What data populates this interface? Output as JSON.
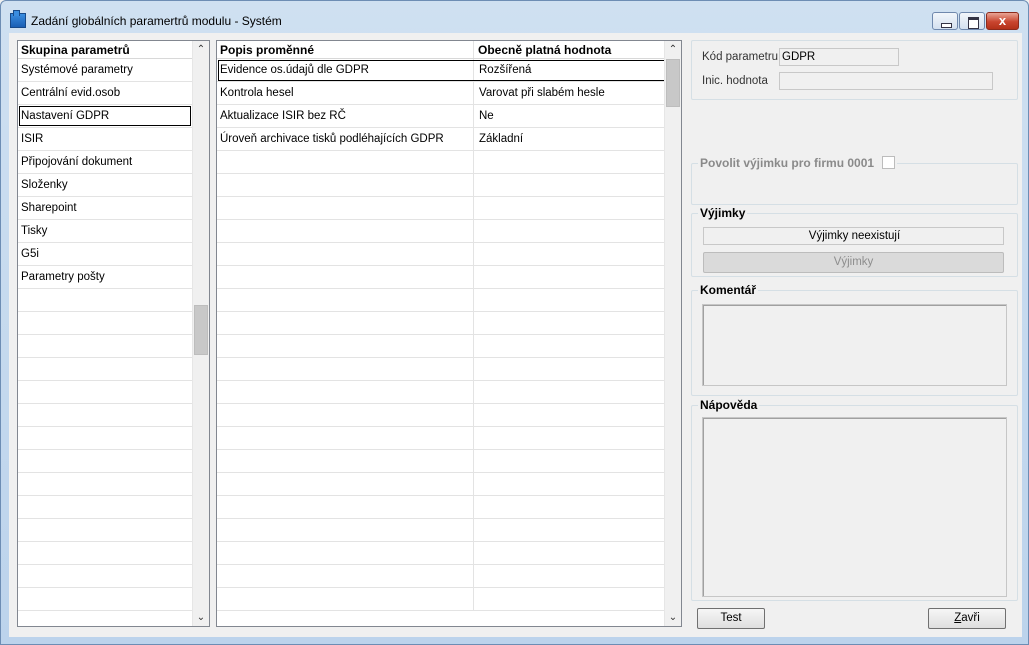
{
  "window": {
    "title": "Zadání globálních paramertrů modulu - Systém",
    "close_glyph": "x"
  },
  "left": {
    "header": "Skupina parametrů",
    "items": [
      "Systémové parametry",
      "Centrální evid.osob",
      "Nastavení GDPR",
      "ISIR",
      "Připojování dokument",
      "Složenky",
      "Sharepoint",
      "Tisky",
      "G5i",
      "Parametry pošty"
    ],
    "selected_index": 2
  },
  "middle": {
    "headers": [
      "Popis proměnné",
      "Obecně platná hodnota"
    ],
    "rows": [
      [
        "Evidence os.údajů dle GDPR",
        "Rozšířená"
      ],
      [
        "Kontrola hesel",
        "Varovat při slabém hesle"
      ],
      [
        "Aktualizace ISIR bez RČ",
        "Ne"
      ],
      [
        "Úroveň archivace tisků podléhajících GDPR",
        "Základní"
      ]
    ]
  },
  "right": {
    "kod_label": "Kód parametru",
    "kod_value": "GDPR",
    "inic_label": "Inic. hodnota",
    "inic_value": "",
    "povolit_label": "Povolit výjimku pro firmu 0001",
    "vyjimky_title": "Výjimky",
    "vyjimky_status": "Výjimky neexistují",
    "vyjimky_button": "Výjimky",
    "komentar_title": "Komentář",
    "napoveda_title": "Nápověda",
    "test_button": "Test",
    "zavri_first": "Z",
    "zavri_rest": "avři"
  }
}
